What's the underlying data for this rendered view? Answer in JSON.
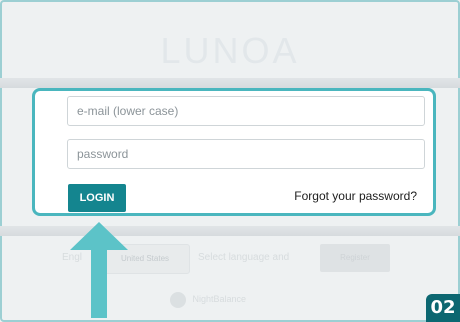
{
  "logo": {
    "text": "LUNOA"
  },
  "login": {
    "email_placeholder": "e-mail (lower case)",
    "password_placeholder": "password",
    "login_label": "LOGIN",
    "forgot_label": "Forgot your password?"
  },
  "language": {
    "current_language": "Engl",
    "country_select": "United States",
    "select_text": "Select language and",
    "register_label": "Register"
  },
  "brand": {
    "name": "NightBalance"
  },
  "annotation": {
    "step_number": "02"
  },
  "colors": {
    "accent": "#4ab6be",
    "login_button": "#14858f",
    "badge": "#0c6771",
    "arrow": "#5cc3c8"
  }
}
